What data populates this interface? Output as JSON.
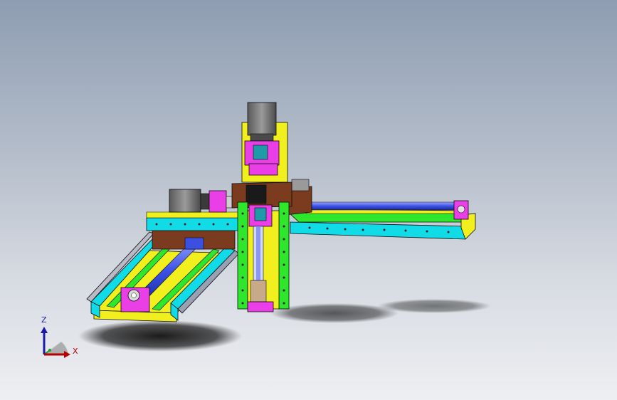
{
  "viewport": {
    "background_top": "#8e9db2",
    "background_bottom": "#eeeff2"
  },
  "model": {
    "description_icon": "xyz-gantry-robot-assembly",
    "colors": {
      "frame_cyan": "#12dbe8",
      "plate_yellow": "#f2ef1e",
      "rail_green": "#2ee62b",
      "block_magenta": "#ea3fe6",
      "plate_brown": "#7a3b1e",
      "motor_gray": "#7f7f7f",
      "screw_blue": "#3b4fe0",
      "shadow": "#1b1b1b"
    }
  },
  "triad": {
    "z_label": "Z",
    "x_label": "X",
    "z_color": "#1a1aa6",
    "x_color": "#b30000",
    "y_color": "#1e9b2a"
  }
}
